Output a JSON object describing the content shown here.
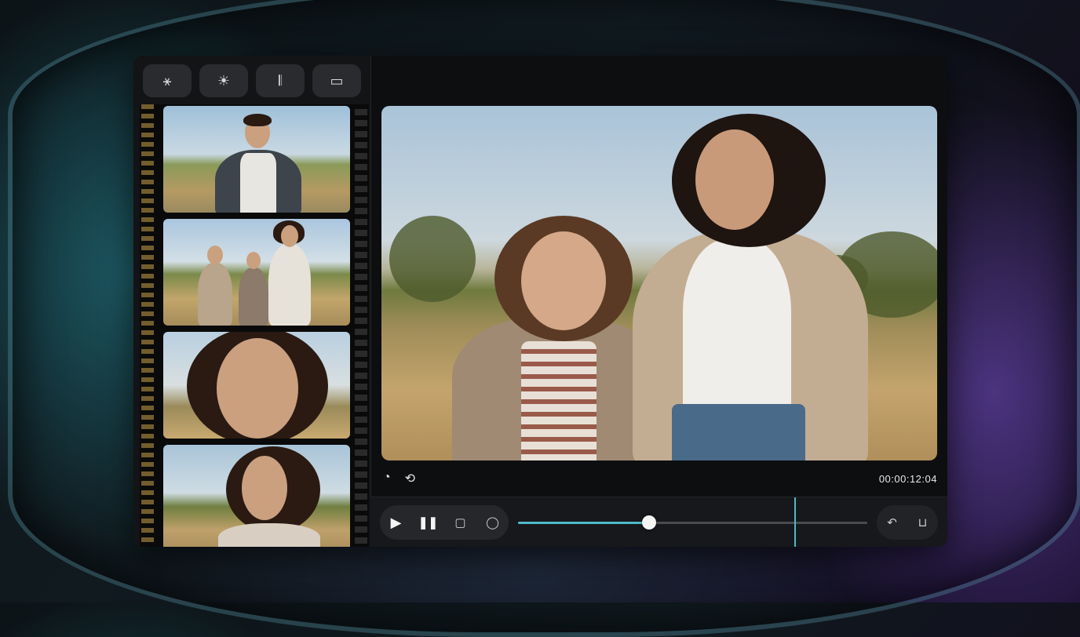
{
  "toolbar": {
    "tools": [
      {
        "icon": "magic-wand-icon",
        "glyph": "⚹"
      },
      {
        "icon": "brightness-icon",
        "glyph": "☀"
      },
      {
        "icon": "audio-waveform-icon",
        "glyph": "𝄃"
      },
      {
        "icon": "captions-icon",
        "glyph": "▭"
      }
    ]
  },
  "filmstrip": {
    "clips": [
      {
        "icon": "clip-thumbnail"
      },
      {
        "icon": "clip-thumbnail"
      },
      {
        "icon": "clip-thumbnail"
      },
      {
        "icon": "clip-thumbnail"
      }
    ]
  },
  "viewer": {
    "meta_icons": [
      {
        "icon": "timer-icon",
        "glyph": "◔"
      },
      {
        "icon": "loop-icon",
        "glyph": "⟲"
      }
    ],
    "timecode": "00:00:12:04"
  },
  "controls": {
    "play_glyph": "▶",
    "pause_glyph": "❚❚",
    "crop_glyph": "▢",
    "comment_glyph": "◯",
    "undo_glyph": "↶",
    "export_glyph": "⊔",
    "progress": 0.375
  },
  "colors": {
    "accent": "#4fb9c9",
    "panel": "#131416",
    "control": "#26272a"
  }
}
